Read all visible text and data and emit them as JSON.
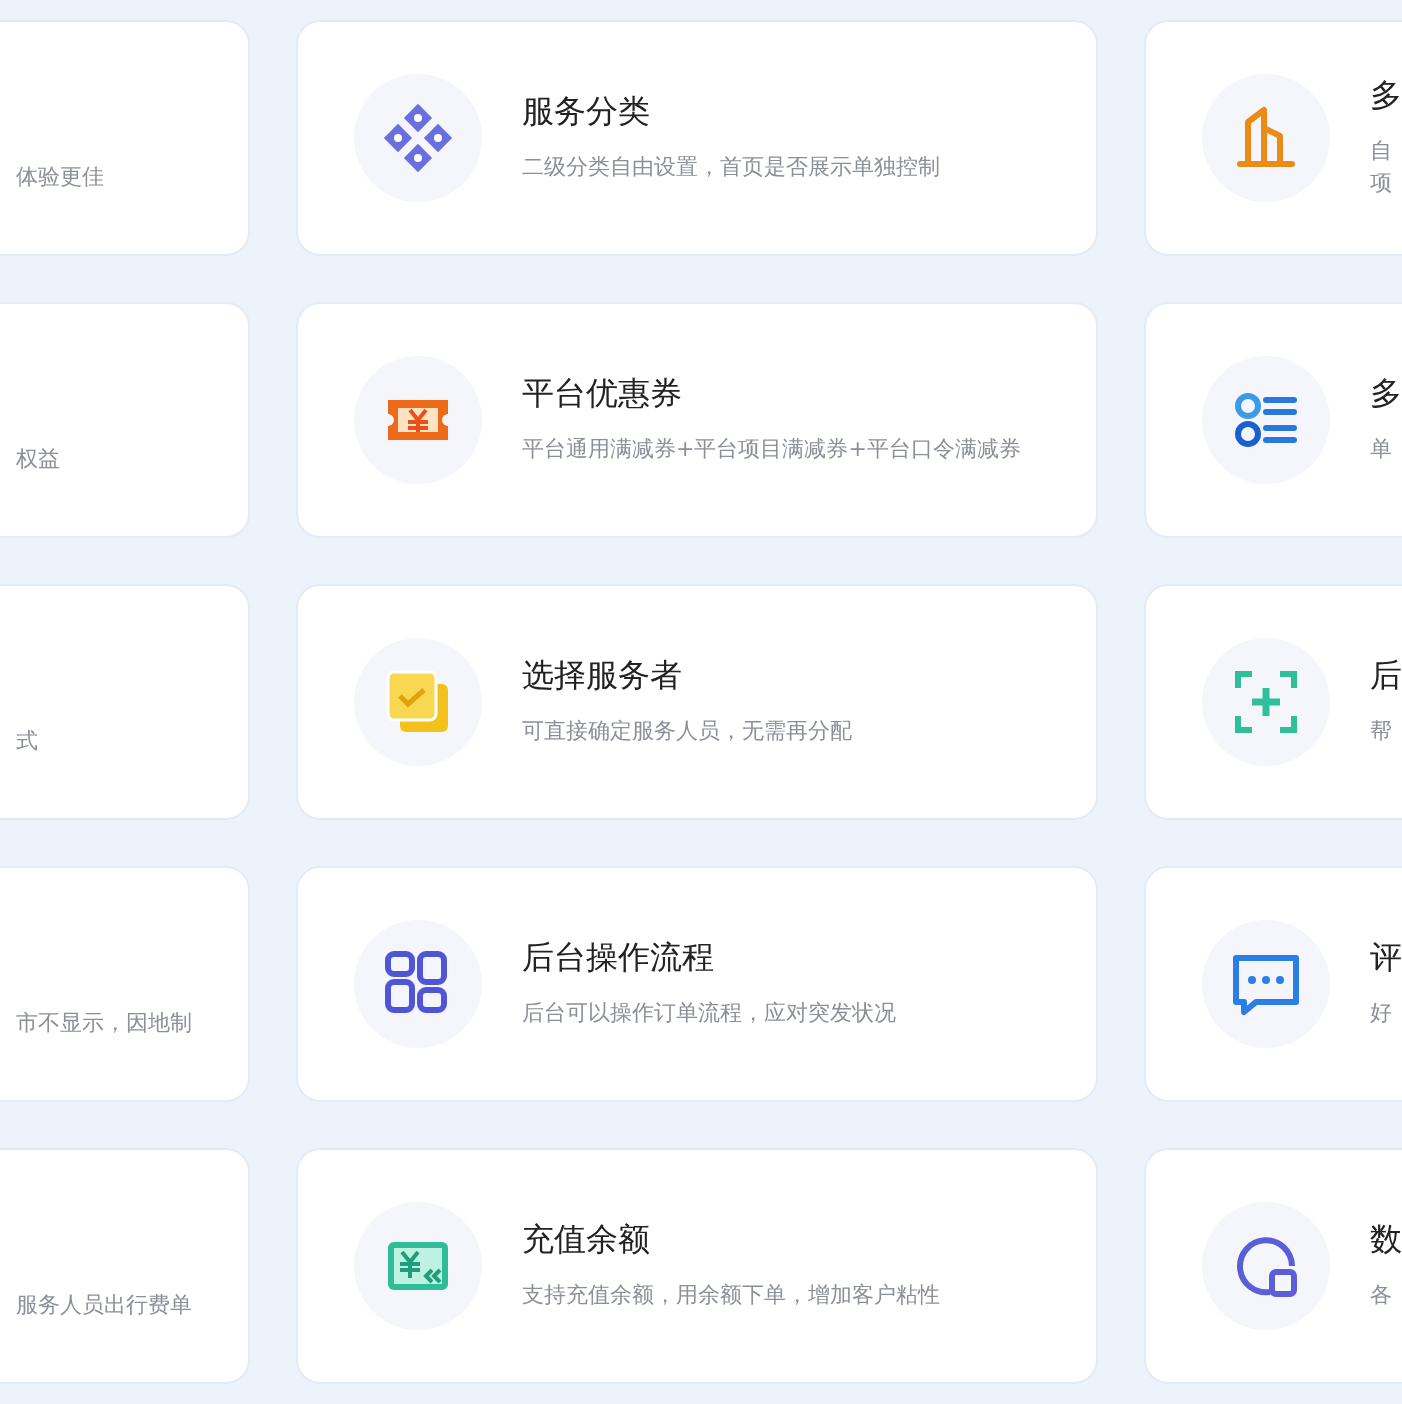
{
  "left_cards": [
    {
      "description": "体验更佳"
    },
    {
      "description": "权益"
    },
    {
      "description": "式"
    },
    {
      "description": "市不显示，因地制"
    },
    {
      "description": "服务人员出行费单"
    }
  ],
  "middle_cards": [
    {
      "title": "服务分类",
      "description": "二级分类自由设置，首页是否展示单独控制"
    },
    {
      "title": "平台优惠券",
      "description": "平台通用满减券+平台项目满减券+平台口令满减券"
    },
    {
      "title": "选择服务者",
      "description": "可直接确定服务人员，无需再分配"
    },
    {
      "title": "后台操作流程",
      "description": "后台可以操作订单流程，应对突发状况"
    },
    {
      "title": "充值余额",
      "description": "支持充值余额，用余额下单，增加客户粘性"
    }
  ],
  "right_cards": [
    {
      "title": "多",
      "description_lines": [
        "自",
        "项"
      ]
    },
    {
      "title": "多",
      "description_lines": [
        "单"
      ]
    },
    {
      "title": "后",
      "description_lines": [
        "帮"
      ]
    },
    {
      "title": "评",
      "description_lines": [
        "好"
      ]
    },
    {
      "title": "数",
      "description_lines": [
        "各"
      ]
    }
  ]
}
